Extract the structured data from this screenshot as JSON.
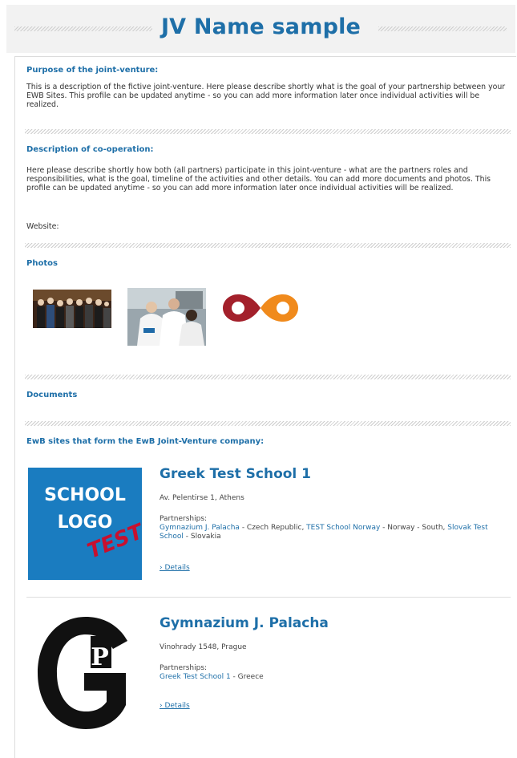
{
  "header": {
    "title": "JV Name sample"
  },
  "purpose": {
    "heading": "Purpose of the joint-venture:",
    "text": "This is a description of the fictive joint-venture. Here please describe shortly what is the goal of your partnership between your EWB Sites. This profile can be updated anytime - so you can add more information later once individual activities will be realized."
  },
  "cooperation": {
    "heading": "Description of co-operation:",
    "text": "Here please describe shortly how both (all partners) participate in this joint-venture - what are the partners roles and responsibilities, what is the goal, timeline of the activities and other details. You can add more documents and photos. This profile can be updated anytime - so you can add more information later once individual activities will be realized.",
    "website_label": "Website:"
  },
  "photos": {
    "heading": "Photos"
  },
  "documents": {
    "heading": "Documents"
  },
  "sites": {
    "heading": "EwB sites that form the EwB Joint-Venture company:",
    "items": [
      {
        "name": "Greek Test School 1",
        "address": "Av. Pelentirse 1, Athens",
        "partnerships_label": "Partnerships:",
        "partners": [
          {
            "name": "Gymnazium J. Palacha",
            "country": " - Czech Republic, "
          },
          {
            "name": "TEST School Norway",
            "country": " - Norway - South, "
          },
          {
            "name": "Slovak Test School",
            "country": " - Slovakia"
          }
        ],
        "details": "› Details",
        "logo": {
          "line1": "SCHOOL",
          "line2": "LOGO",
          "stamp": "TEST"
        }
      },
      {
        "name": "Gymnazium J. Palacha",
        "address": "Vinohrady 1548, Prague",
        "partnerships_label": "Partnerships:",
        "partners": [
          {
            "name": "Greek Test School 1",
            "country": " - Greece"
          }
        ],
        "details": "› Details"
      }
    ]
  },
  "colors": {
    "accent": "#1e6fa8",
    "logo_blue": "#1a7cc0",
    "stamp_red": "#c8102e",
    "infinity_red": "#a3202b",
    "infinity_orange": "#f08a1c"
  }
}
